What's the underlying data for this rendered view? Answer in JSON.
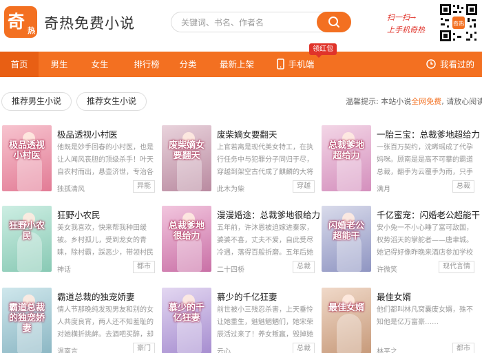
{
  "header": {
    "logo_char_big": "奇",
    "logo_char_small": "热",
    "logo_text": "奇热免费小说",
    "search_placeholder": "关键词、书名、作者名",
    "promo_line1": "扫一扫→",
    "promo_line2": "上手机奇热",
    "qr_logo_text": "奇热"
  },
  "nav": {
    "items": [
      {
        "label": "首页"
      },
      {
        "label": "男生"
      },
      {
        "label": "女生"
      },
      {
        "label": "排行榜"
      },
      {
        "label": "分类"
      },
      {
        "label": "最新上架"
      },
      {
        "label": "手机端"
      },
      {
        "label": "我看过的"
      }
    ],
    "badge": "领红包"
  },
  "filters": {
    "male": "推荐男生小说",
    "female": "推荐女生小说",
    "notice_prefix": "温馨提示: 本站小说",
    "notice_highlight": "全网免费",
    "notice_suffix": ", 请放心阅读!"
  },
  "books": [
    {
      "title": "极品透视小村医",
      "desc": "他既是妙手回春的小村医，也是让人闻风丧胆的顶级杀手！叶天自农村而出，悬壶济世，专治各种疑…",
      "author": "独孤清风",
      "tag": "异能",
      "cover_text": "极品透视小村医"
    },
    {
      "title": "废柴嫡女要翻天",
      "desc": "上官若离是现代美女特工，在执行任务中与犯罪分子同归于尽，穿越到架空古代成了麒麟的大将军府…",
      "author": "此木为柴",
      "tag": "穿越",
      "cover_text": "废柴嫡女要翻天"
    },
    {
      "title": "一胎三宝：总裁爹地超给力",
      "desc": "一张百万契约，沈晞瑶成了代孕妈咪。顾南是是高不可攀的霸道总裁，翻手为云覆手为雨，只手可…",
      "author": "满月",
      "tag": "总裁",
      "cover_text": "总裁爹地超给力"
    },
    {
      "title": "狂野小农民",
      "desc": "美女我喜欢，快来帮我种田缓被。乡村孤儿，受到龙女的青睐，除村霸，踩恶少，带领村民勤劳致富…",
      "author": "神话",
      "tag": "都市",
      "cover_text": "狂野小农民"
    },
    {
      "title": "漫漫婚途：总裁爹地很给力",
      "desc": "五年前，许沐恩被迫嫁进秦家，婆婆不喜，丈夫不爱，自此受尽冷遇，落得百般折磨。五年后她强…",
      "author": "二十四桥",
      "tag": "总裁",
      "cover_text": "总裁爹地很给力"
    },
    {
      "title": "千亿蜜宠：闪婚老公超能干",
      "desc": "安小兔一不小心睡了富可敌国，权势滔天的掌舵者——唐聿城。她记得好像昨晚来酒店参加学校举办…",
      "author": "许微笑",
      "tag": "现代言情",
      "cover_text": "闪婚老公超能干"
    },
    {
      "title": "霸道总裁的独宠娇妻",
      "desc": "情人节那晚纯发现男友和别的女人共度良宵，两人还不知羞耻的对她横折挑衅。去酒吧买醉，却被迷…",
      "author": "温南言",
      "tag": "豪门",
      "cover_text": "霸道总裁的独宠娇妻"
    },
    {
      "title": "慕少的千亿狂妻",
      "desc": "前世被小三残忍杀害，上天垂怜让她重生，魅魅魍魉们，她宋荣辰活过来了！养女叛羸，毁掉她把她…",
      "author": "云心",
      "tag": "总裁",
      "cover_text": "慕少的千亿狂妻"
    },
    {
      "title": "最佳女婿",
      "desc": "他们都叫林凡窝囊废女婿，殊不知他是亿万富豪……",
      "author": "林平之",
      "tag": "都市",
      "cover_text": "最佳女婿"
    }
  ],
  "colors": {
    "accent": "#f37021",
    "accent_dark": "#e85f14",
    "red": "#e0332a"
  }
}
